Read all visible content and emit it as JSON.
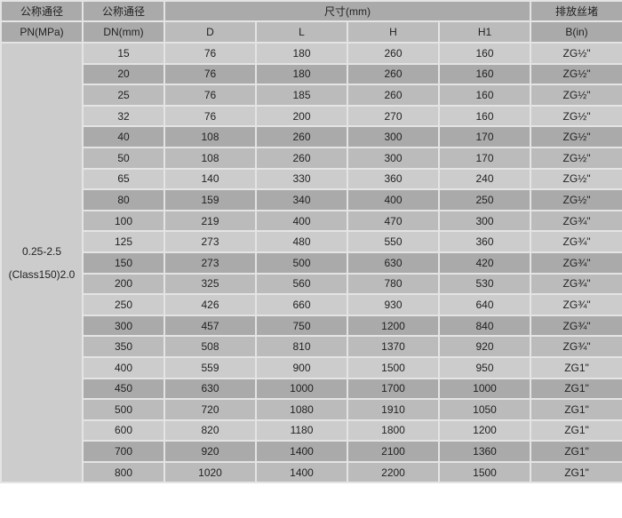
{
  "header": {
    "pn_title": "公称通径",
    "pn_unit": "PN(MPa)",
    "dn_title": "公称通径",
    "dn_unit": "DN(mm)",
    "dims_title": "尺寸(mm)",
    "dims_cols": [
      "D",
      "L",
      "H",
      "H1"
    ],
    "drain_title": "排放丝堵",
    "drain_unit": "B(in)"
  },
  "pressure": {
    "line1": "0.25-2.5",
    "line2": "(Class150)2.0"
  },
  "rows": [
    {
      "dn": "15",
      "d": "76",
      "l": "180",
      "h": "260",
      "h1": "160",
      "b": "ZG½\""
    },
    {
      "dn": "20",
      "d": "76",
      "l": "180",
      "h": "260",
      "h1": "160",
      "b": "ZG½\""
    },
    {
      "dn": "25",
      "d": "76",
      "l": "185",
      "h": "260",
      "h1": "160",
      "b": "ZG½\""
    },
    {
      "dn": "32",
      "d": "76",
      "l": "200",
      "h": "270",
      "h1": "160",
      "b": "ZG½\""
    },
    {
      "dn": "40",
      "d": "108",
      "l": "260",
      "h": "300",
      "h1": "170",
      "b": "ZG½\""
    },
    {
      "dn": "50",
      "d": "108",
      "l": "260",
      "h": "300",
      "h1": "170",
      "b": "ZG½\""
    },
    {
      "dn": "65",
      "d": "140",
      "l": "330",
      "h": "360",
      "h1": "240",
      "b": "ZG½\""
    },
    {
      "dn": "80",
      "d": "159",
      "l": "340",
      "h": "400",
      "h1": "250",
      "b": "ZG½\""
    },
    {
      "dn": "100",
      "d": "219",
      "l": "400",
      "h": "470",
      "h1": "300",
      "b": "ZG¾\""
    },
    {
      "dn": "125",
      "d": "273",
      "l": "480",
      "h": "550",
      "h1": "360",
      "b": "ZG¾\""
    },
    {
      "dn": "150",
      "d": "273",
      "l": "500",
      "h": "630",
      "h1": "420",
      "b": "ZG¾\""
    },
    {
      "dn": "200",
      "d": "325",
      "l": "560",
      "h": "780",
      "h1": "530",
      "b": "ZG¾\""
    },
    {
      "dn": "250",
      "d": "426",
      "l": "660",
      "h": "930",
      "h1": "640",
      "b": "ZG¾\""
    },
    {
      "dn": "300",
      "d": "457",
      "l": "750",
      "h": "1200",
      "h1": "840",
      "b": "ZG¾\""
    },
    {
      "dn": "350",
      "d": "508",
      "l": "810",
      "h": "1370",
      "h1": "920",
      "b": "ZG¾\""
    },
    {
      "dn": "400",
      "d": "559",
      "l": "900",
      "h": "1500",
      "h1": "950",
      "b": "ZG1\""
    },
    {
      "dn": "450",
      "d": "630",
      "l": "1000",
      "h": "1700",
      "h1": "1000",
      "b": "ZG1\""
    },
    {
      "dn": "500",
      "d": "720",
      "l": "1080",
      "h": "1910",
      "h1": "1050",
      "b": "ZG1\""
    },
    {
      "dn": "600",
      "d": "820",
      "l": "1180",
      "h": "1800",
      "h1": "1200",
      "b": "ZG1\""
    },
    {
      "dn": "700",
      "d": "920",
      "l": "1400",
      "h": "2100",
      "h1": "1360",
      "b": "ZG1\""
    },
    {
      "dn": "800",
      "d": "1020",
      "l": "1400",
      "h": "2200",
      "h1": "1500",
      "b": "ZG1\""
    }
  ],
  "colors": {
    "row_light": "#cccccc",
    "row_dark": "#aaaaaa",
    "row_mid": "#bbbbbb",
    "grid_line": "#e4e4e4"
  }
}
